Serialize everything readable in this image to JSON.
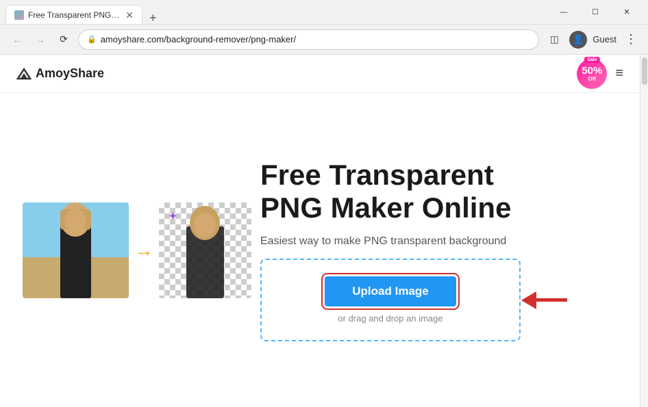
{
  "browser": {
    "tab": {
      "title": "Free Transparent PNG Maker -",
      "favicon_label": "amoyshare-favicon"
    },
    "new_tab_label": "+",
    "window_controls": {
      "minimize": "—",
      "maximize": "☐",
      "close": "✕"
    },
    "address": "amoyshare.com/background-remover/png-maker/",
    "address_icon": "🔒",
    "profile_label": "Guest",
    "profile_icon": "👤"
  },
  "header": {
    "logo_text": "AmoyShare",
    "sale_badge": {
      "tag": "Sale",
      "percent": "50%",
      "off": "Off"
    },
    "hamburger": "≡"
  },
  "main": {
    "title_line1": "Free Transparent",
    "title_line2": "PNG Maker Online",
    "subtitle": "Easiest way to make PNG transparent background",
    "upload_btn_label": "Upload Image",
    "drag_drop_text": "or drag and drop an image"
  }
}
